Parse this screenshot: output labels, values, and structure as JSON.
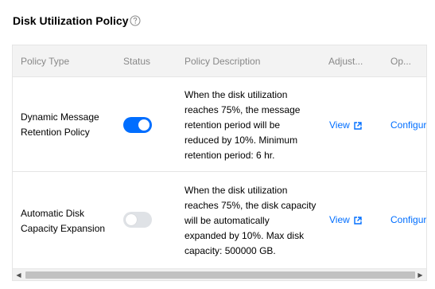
{
  "section": {
    "title": "Disk Utilization Policy",
    "help_icon": "question-circle-icon"
  },
  "table": {
    "columns": [
      "Policy Type",
      "Status",
      "Policy Description",
      "Adjust...",
      "Op..."
    ],
    "rows": [
      {
        "type_lines": [
          "Dynamic Message",
          "Retention Policy"
        ],
        "status": "on",
        "desc_lines": [
          "When the disk utilization",
          "reaches 75%, the message",
          "retention period will be",
          "reduced by 10%. Minimum",
          "retention period: 6 hr."
        ],
        "adjust_label": "View",
        "operation_label": "Configure"
      },
      {
        "type_lines": [
          "Automatic Disk",
          "Capacity Expansion"
        ],
        "status": "off",
        "desc_lines": [
          "When the disk utilization",
          "reaches 75%, the disk capacity",
          "will be automatically",
          "expanded by 10%. Max disk",
          "capacity: 500000 GB."
        ],
        "adjust_label": "View",
        "operation_label": "Configure"
      }
    ]
  },
  "colors": {
    "accent": "#006eff",
    "toggle_off": "#dfe2e6",
    "header_bg": "#f3f3f3"
  }
}
